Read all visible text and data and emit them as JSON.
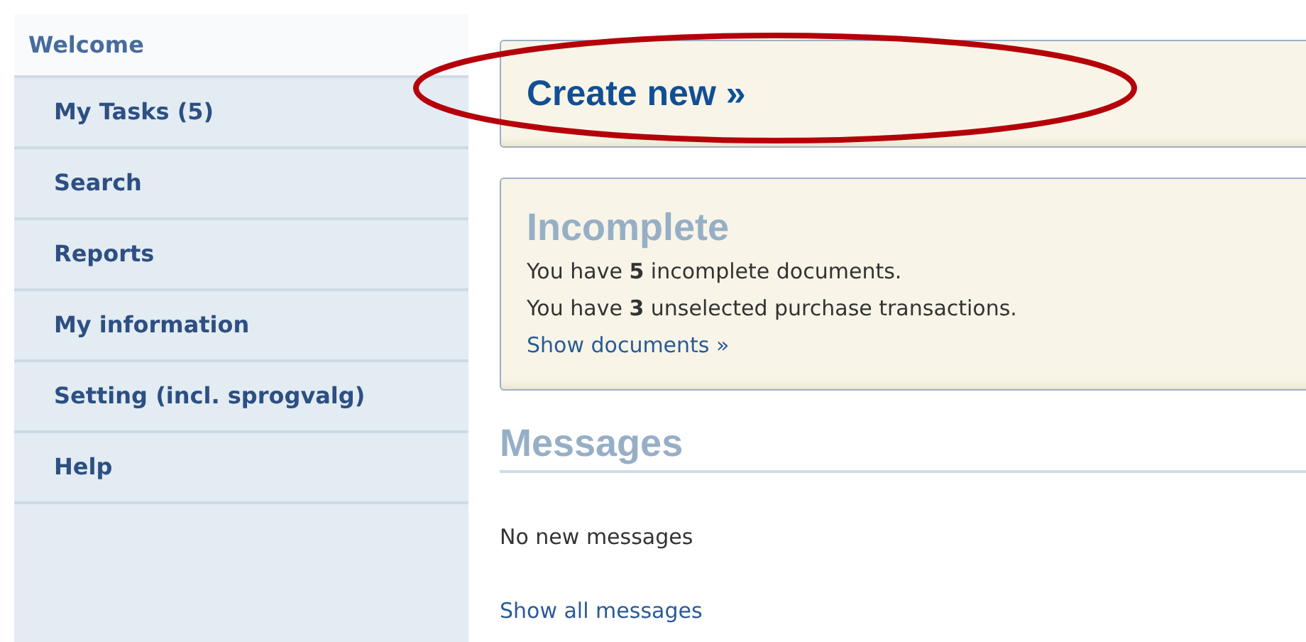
{
  "sidebar": {
    "items": [
      {
        "label": "Welcome",
        "selected": true
      },
      {
        "label": "My Tasks (5)",
        "selected": false
      },
      {
        "label": "Search",
        "selected": false
      },
      {
        "label": "Reports",
        "selected": false
      },
      {
        "label": "My information",
        "selected": false
      },
      {
        "label": "Setting (incl. sprogvalg)",
        "selected": false
      },
      {
        "label": "Help",
        "selected": false
      }
    ]
  },
  "create_panel": {
    "title": "Create new »"
  },
  "incomplete_panel": {
    "title": "Incomplete",
    "lines": [
      "You have **5** incomplete documents.",
      "You have **3** unselected purchase transactions."
    ],
    "link": "Show documents »"
  },
  "messages": {
    "heading": "Messages",
    "text": "No new messages",
    "link": "Show all messages"
  },
  "annotation": {
    "kind": "ellipse"
  }
}
